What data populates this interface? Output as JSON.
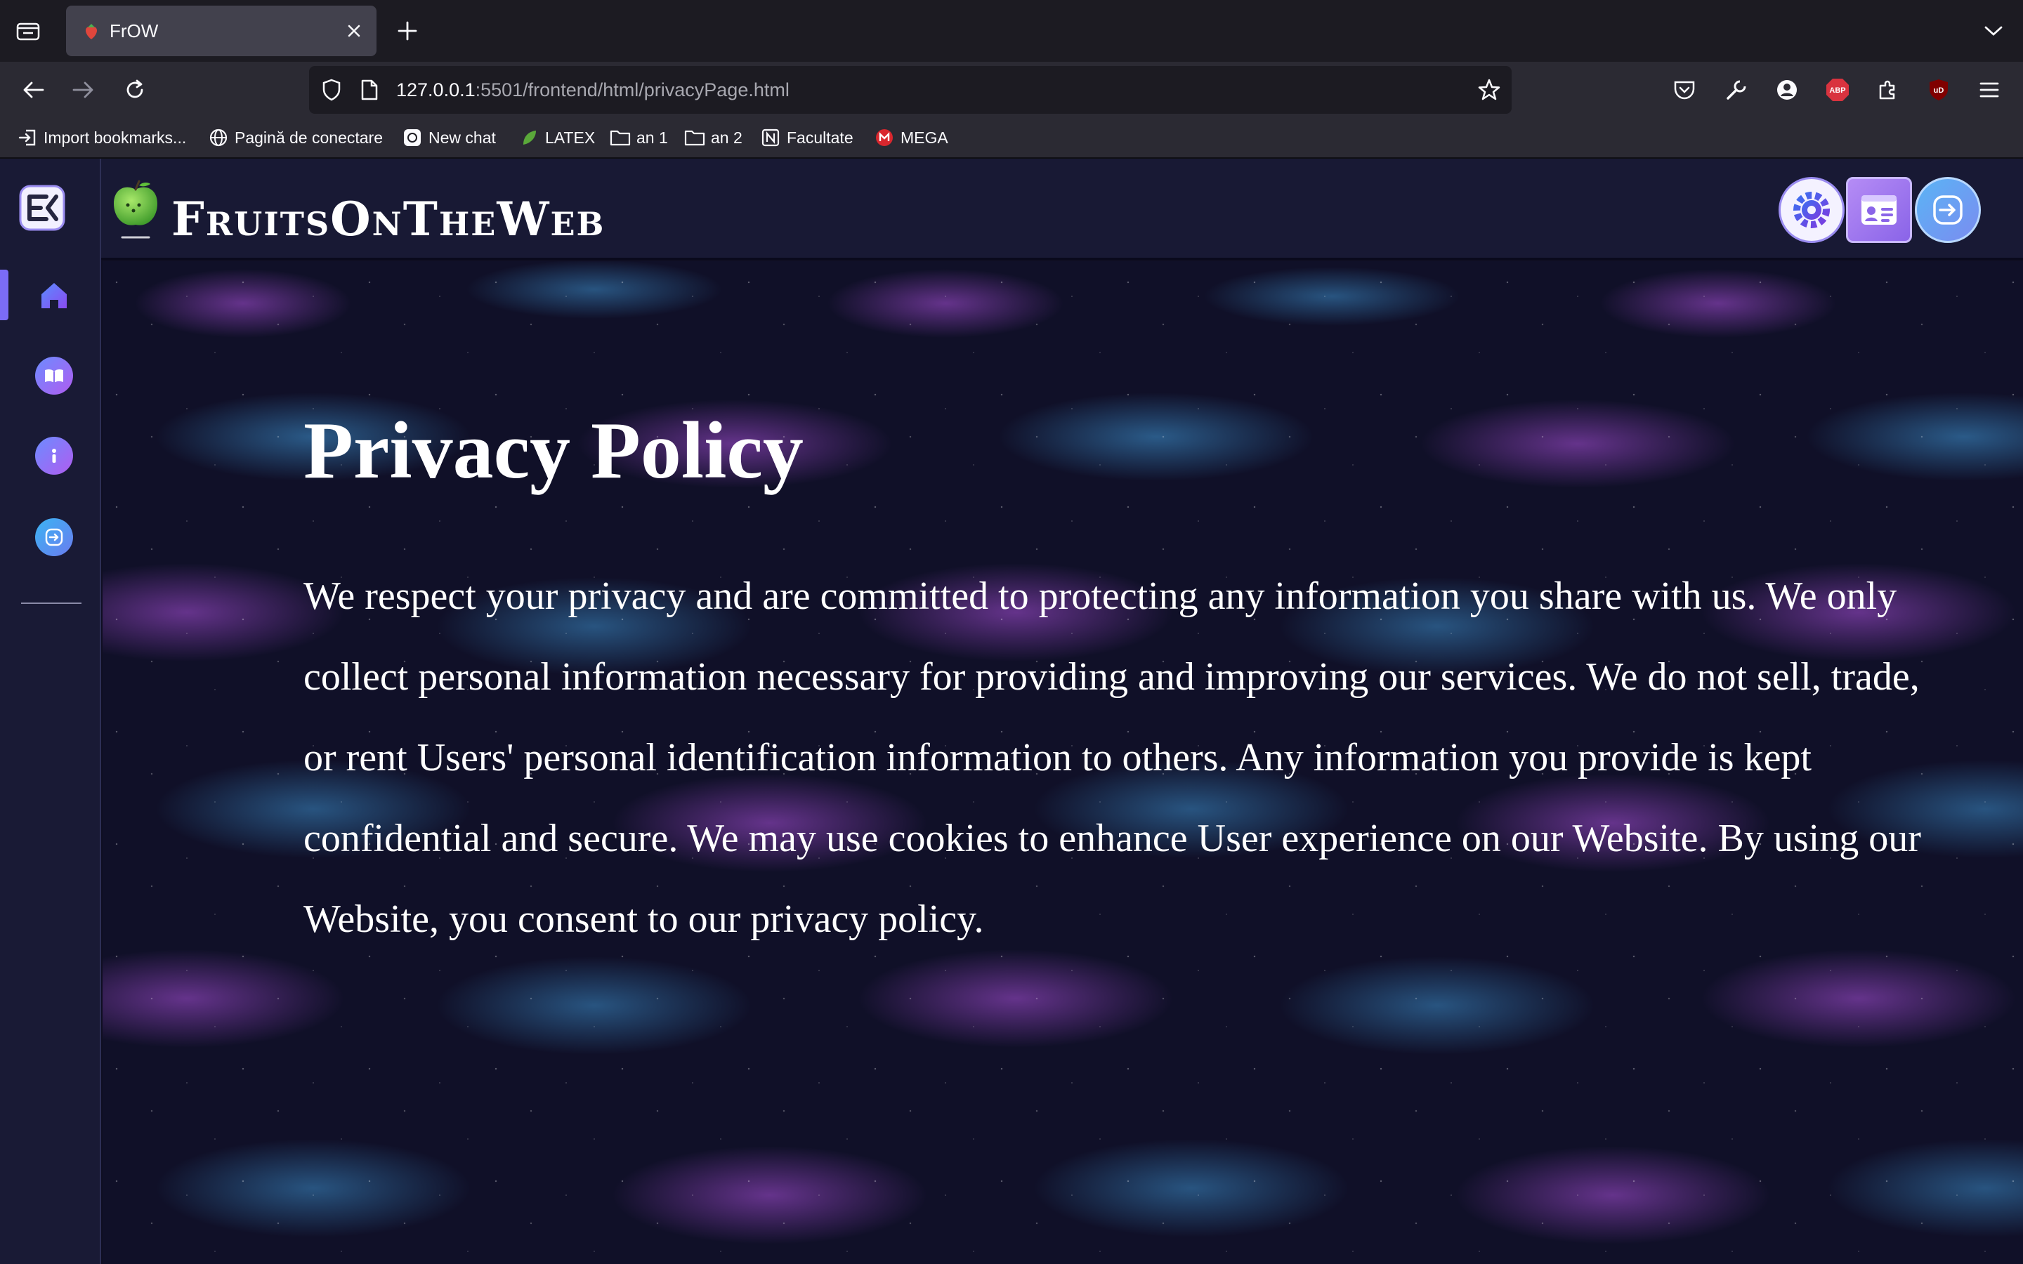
{
  "browser": {
    "tab": {
      "title": "FrOW"
    },
    "url": {
      "host": "127.0.0.1",
      "rest": ":5501/frontend/html/privacyPage.html"
    },
    "bookmarks": [
      {
        "label": "Import bookmarks...",
        "icon": "import-icon"
      },
      {
        "label": "Pagină de conectare",
        "icon": "globe-icon"
      },
      {
        "label": "New chat",
        "icon": "chatgpt-icon"
      },
      {
        "label": "LATEX",
        "icon": "leaf-icon"
      },
      {
        "label": "an 1",
        "icon": "folder-icon"
      },
      {
        "label": "an 2",
        "icon": "folder-icon"
      },
      {
        "label": "Facultate",
        "icon": "notion-icon"
      },
      {
        "label": "MEGA",
        "icon": "mega-icon"
      }
    ],
    "extensions": {
      "adblock_label": "ABP",
      "ublock_label": "uD"
    }
  },
  "app": {
    "brand": "FruitsOnTheWeb",
    "sidebar": {
      "items": [
        {
          "name": "home",
          "icon": "home-icon",
          "active": true
        },
        {
          "name": "catalog",
          "icon": "book-icon"
        },
        {
          "name": "about",
          "icon": "info-icon"
        },
        {
          "name": "login",
          "icon": "login-icon"
        }
      ]
    },
    "header_buttons": [
      "settings-icon",
      "profile-icon",
      "logout-icon"
    ]
  },
  "content": {
    "title": "Privacy Policy",
    "body": "We respect your privacy and are committed to protecting any information you share with us. We only collect personal information necessary for providing and improving our services. We do not sell, trade, or rent Users' personal identification information to others. Any information you provide is kept confidential and secure. We may use cookies to enhance User experience on our Website. By using our Website, you consent to our privacy policy."
  },
  "colors": {
    "chrome_bg": "#1c1b22",
    "toolbar_bg": "#2b2a33",
    "sidebar_bg": "#191a35",
    "accent": "#7b6cf6",
    "text": "#ffffff"
  }
}
